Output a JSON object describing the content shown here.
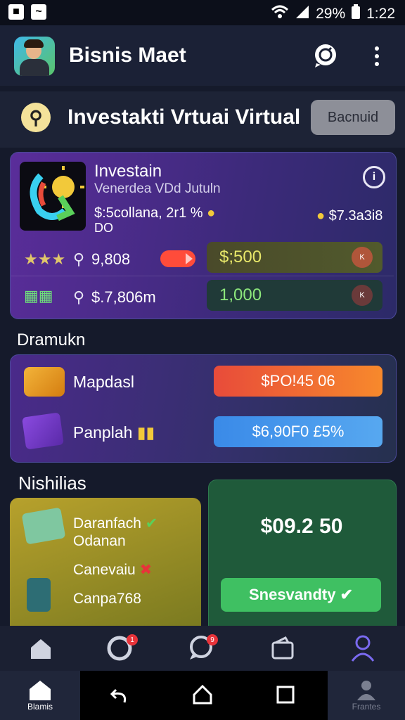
{
  "status_bar": {
    "battery": "29%",
    "time": "1:22"
  },
  "app_bar": {
    "title": "Bisnis Maet"
  },
  "section": {
    "title": "Investakti Vrtuai Virtual",
    "button": "Bacnuid"
  },
  "investment_card": {
    "title": "Investain",
    "subtitle": "Venerdea VDd Jutuln",
    "line1": "$:5collana, 2r1 %",
    "line2": "DO",
    "right_value": "$7.3a3i8",
    "row1_value": "9,808",
    "row1_amount": "$;500",
    "row2_value": "$.7,806m",
    "row2_amount": "1,000"
  },
  "programs": {
    "label": "Dramukn",
    "items": [
      {
        "title": "Mapdasl",
        "button": "$PO!45 06"
      },
      {
        "title": "Panplah",
        "button": "$6,90F0 £5%"
      }
    ]
  },
  "ms_section": {
    "label": "Nishilias",
    "yellow_line1": "Daranfach",
    "yellow_line2": "Odanan",
    "yellow_line3": "Canevaiu",
    "yellow_line4": "Canpa768",
    "green_value": "$09.2 50",
    "green_button": "Snesvandty"
  },
  "nav": {
    "home_label": "Blamis",
    "profile_label": "Frantes"
  },
  "colors": {
    "accent_red": "#e84b3a",
    "accent_green": "#3fc062",
    "accent_blue": "#3a8ae8"
  }
}
